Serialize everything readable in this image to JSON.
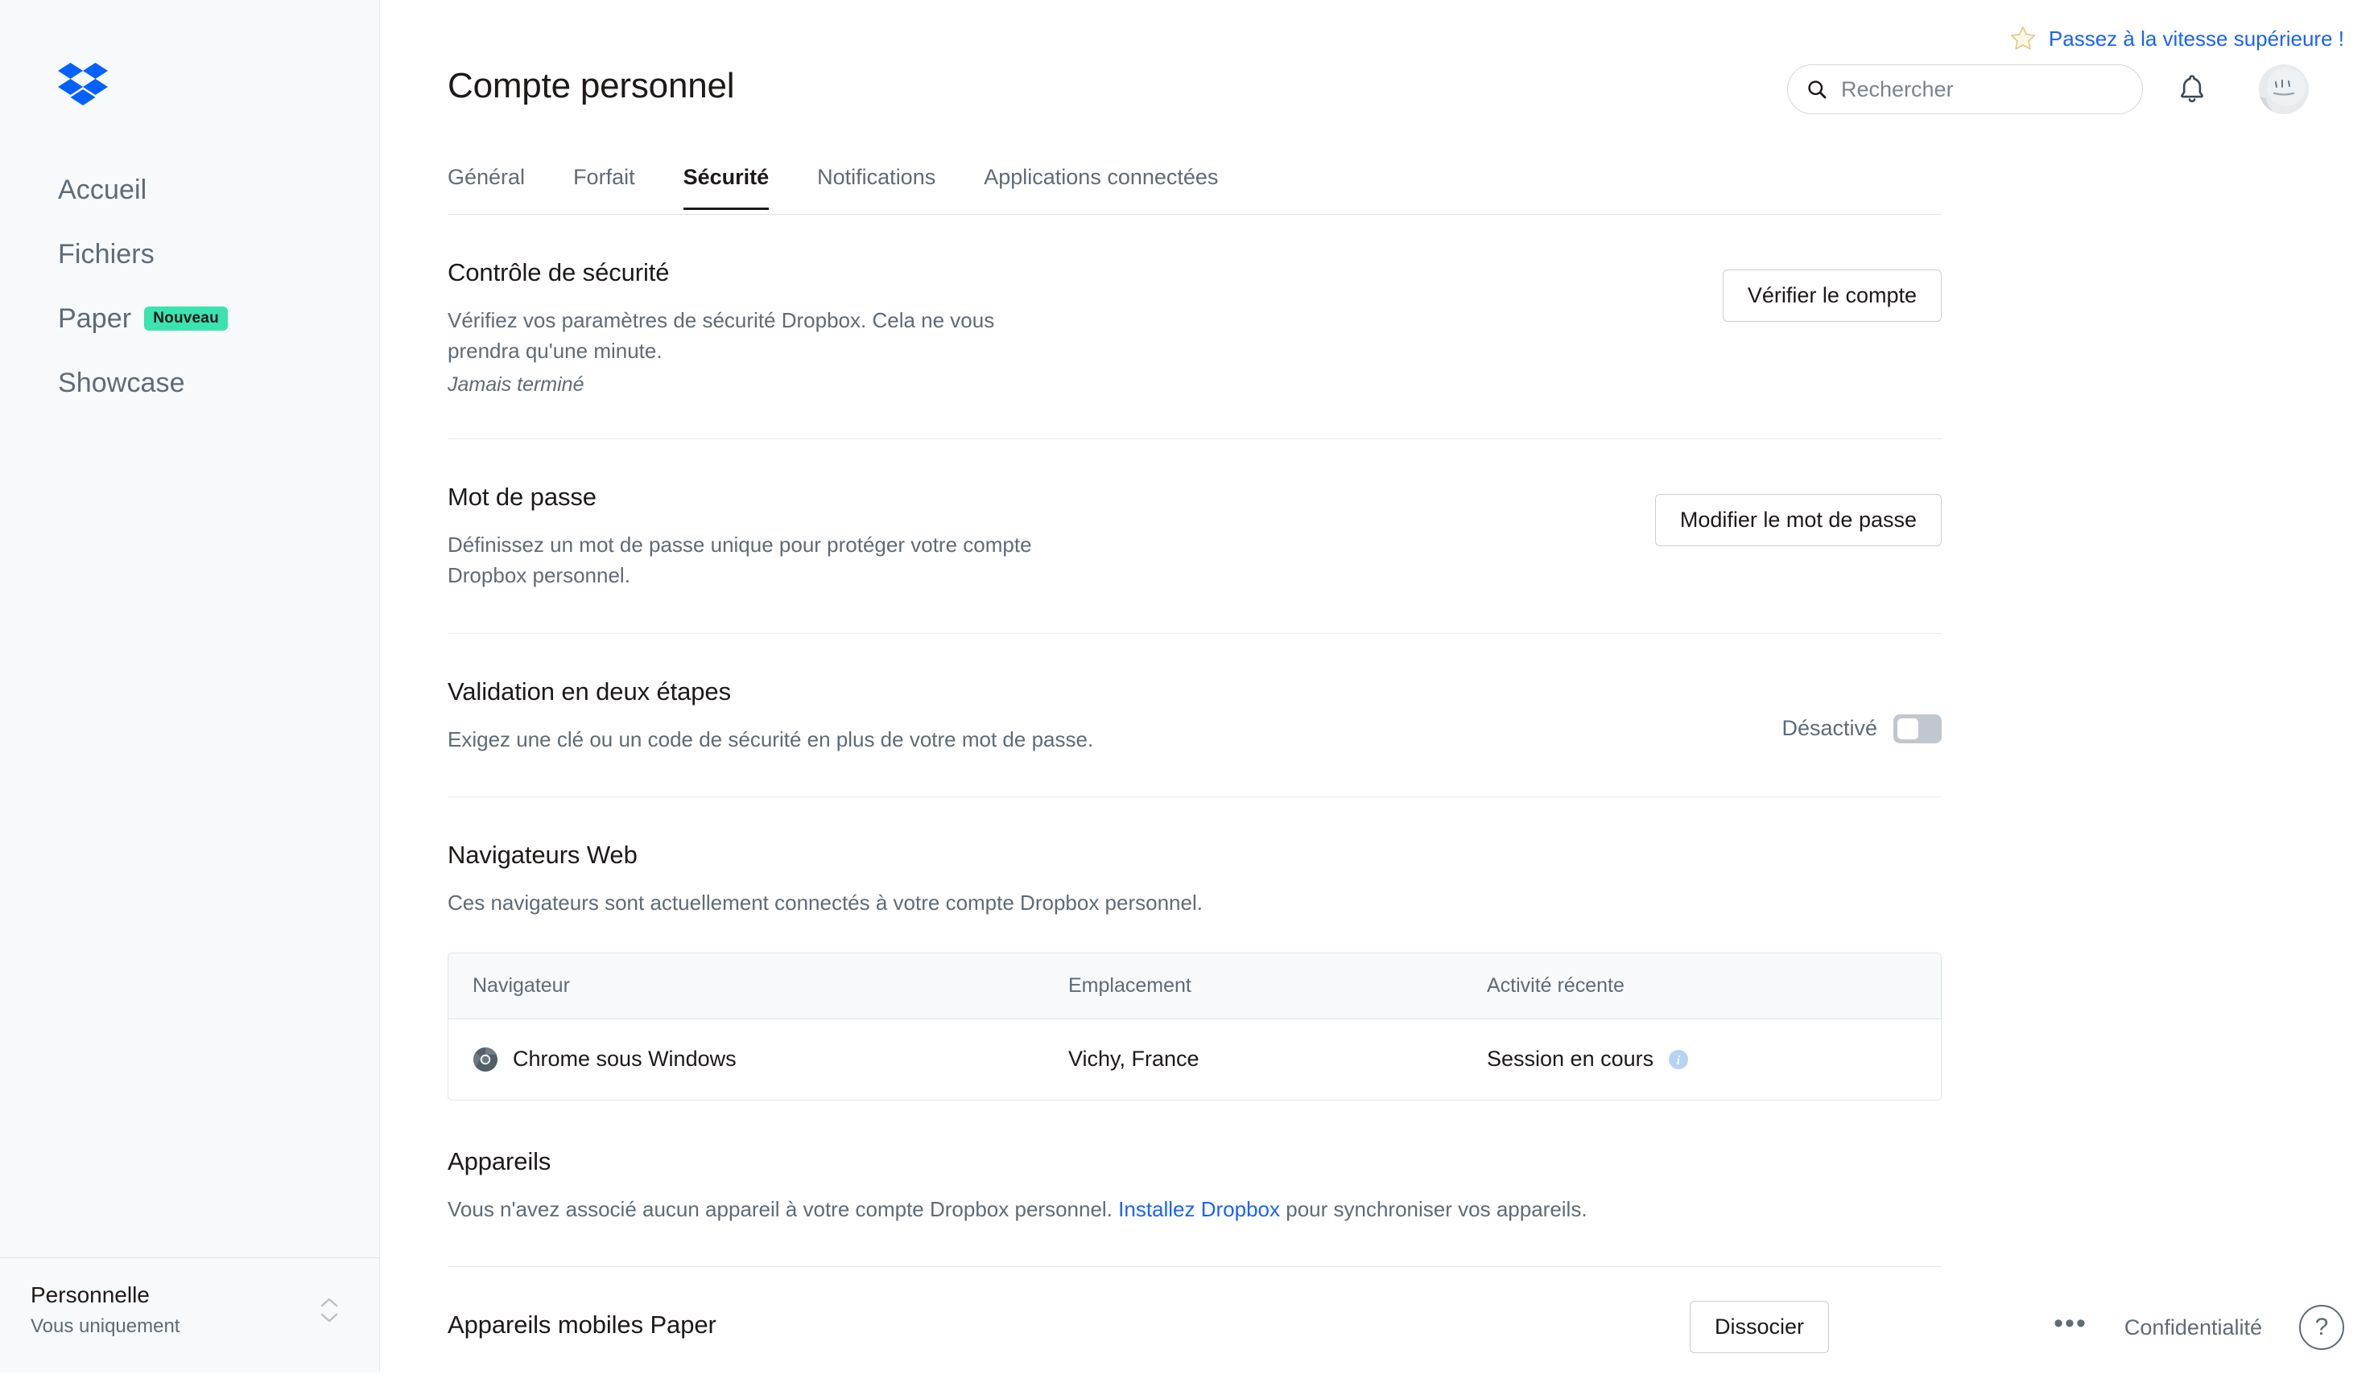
{
  "sidebar": {
    "logo_icon": "dropbox-logo",
    "items": [
      {
        "label": "Accueil"
      },
      {
        "label": "Fichiers"
      },
      {
        "label": "Paper",
        "badge": "Nouveau"
      },
      {
        "label": "Showcase"
      }
    ],
    "account": {
      "name": "Personnelle",
      "subtitle": "Vous uniquement"
    }
  },
  "promo": {
    "icon": "star-icon",
    "text": "Passez à la vitesse supérieure !",
    "color": "#1a62ff"
  },
  "header": {
    "title": "Compte personnel",
    "search_placeholder": "Rechercher",
    "search_value": "",
    "search_icon": "search-icon",
    "bell_icon": "bell-icon",
    "avatar_icon": "avatar"
  },
  "tabs": [
    {
      "label": "Général",
      "active": false
    },
    {
      "label": "Forfait",
      "active": false
    },
    {
      "label": "Sécurité",
      "active": true
    },
    {
      "label": "Notifications",
      "active": false
    },
    {
      "label": "Applications connectées",
      "active": false
    }
  ],
  "sections": {
    "security_check": {
      "title": "Contrôle de sécurité",
      "description": "Vérifiez vos paramètres de sécurité Dropbox. Cela ne vous prendra qu'une minute.",
      "note": "Jamais terminé",
      "button": "Vérifier le compte"
    },
    "password": {
      "title": "Mot de passe",
      "description": "Définissez un mot de passe unique pour protéger votre compte Dropbox personnel.",
      "button": "Modifier le mot de passe"
    },
    "two_step": {
      "title": "Validation en deux étapes",
      "description": "Exigez une clé ou un code de sécurité en plus de votre mot de passe.",
      "toggle_label": "Désactivé",
      "toggle_state": "off"
    },
    "browsers": {
      "title": "Navigateurs Web",
      "description": "Ces navigateurs sont actuellement connectés à votre compte Dropbox personnel.",
      "columns": [
        "Navigateur",
        "Emplacement",
        "Activité récente"
      ],
      "rows": [
        {
          "browser": "Chrome sous Windows",
          "browser_icon": "chrome-icon",
          "location": "Vichy, France",
          "activity": "Session en cours",
          "activity_icon": "info-icon"
        }
      ]
    },
    "devices": {
      "title": "Appareils",
      "description_before": "Vous n'avez associé aucun appareil à votre compte Dropbox personnel. ",
      "link": "Installez Dropbox",
      "description_after": " pour synchroniser vos appareils."
    },
    "paper_devices": {
      "title": "Appareils mobiles Paper",
      "button": "Dissocier"
    }
  },
  "footer": {
    "more_label": "•••",
    "privacy": "Confidentialité",
    "help_label": "?"
  }
}
